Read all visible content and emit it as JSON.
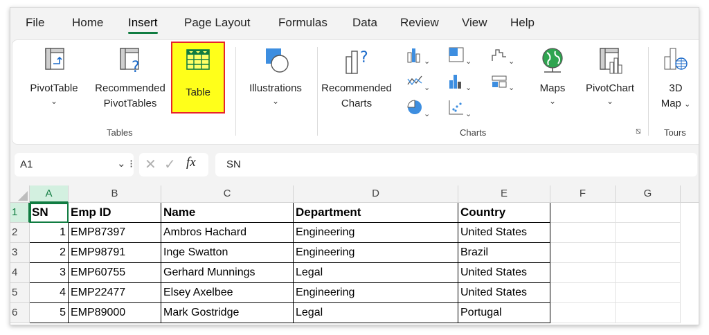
{
  "menu": {
    "tabs": [
      "File",
      "Home",
      "Insert",
      "Page Layout",
      "Formulas",
      "Data",
      "Review",
      "View",
      "Help"
    ],
    "active": "Insert"
  },
  "ribbon": {
    "pivottable": "PivotTable",
    "recommended_pivot_line1": "Recommended",
    "recommended_pivot_line2": "PivotTables",
    "table": "Table",
    "illustrations": "Illustrations",
    "recommended_charts_line1": "Recommended",
    "recommended_charts_line2": "Charts",
    "maps": "Maps",
    "pivotchart": "PivotChart",
    "map3d_line1": "3D",
    "map3d_line2": "Map",
    "groups": {
      "tables": "Tables",
      "charts": "Charts",
      "tours": "Tours"
    }
  },
  "formula_bar": {
    "name_box": "A1",
    "formula": "SN",
    "fx": "fx"
  },
  "columns": [
    "A",
    "B",
    "C",
    "D",
    "E",
    "F",
    "G"
  ],
  "rows": [
    "1",
    "2",
    "3",
    "4",
    "5",
    "6"
  ],
  "table": {
    "headers": [
      "SN",
      "Emp ID",
      "Name",
      "Department",
      "Country"
    ],
    "rows": [
      [
        "1",
        "EMP87397",
        "Ambros Hachard",
        "Engineering",
        "United States"
      ],
      [
        "2",
        "EMP98791",
        "Inge Swatton",
        "Engineering",
        "Brazil"
      ],
      [
        "3",
        "EMP60755",
        "Gerhard Munnings",
        "Legal",
        "United States"
      ],
      [
        "4",
        "EMP22477",
        "Elsey Axelbee",
        "Engineering",
        "United States"
      ],
      [
        "5",
        "EMP89000",
        "Mark Gostridge",
        "Legal",
        "Portugal"
      ]
    ]
  },
  "colors": {
    "accent": "#107c41",
    "highlight": "#ffff1a",
    "highlight_border": "#e8242b"
  }
}
